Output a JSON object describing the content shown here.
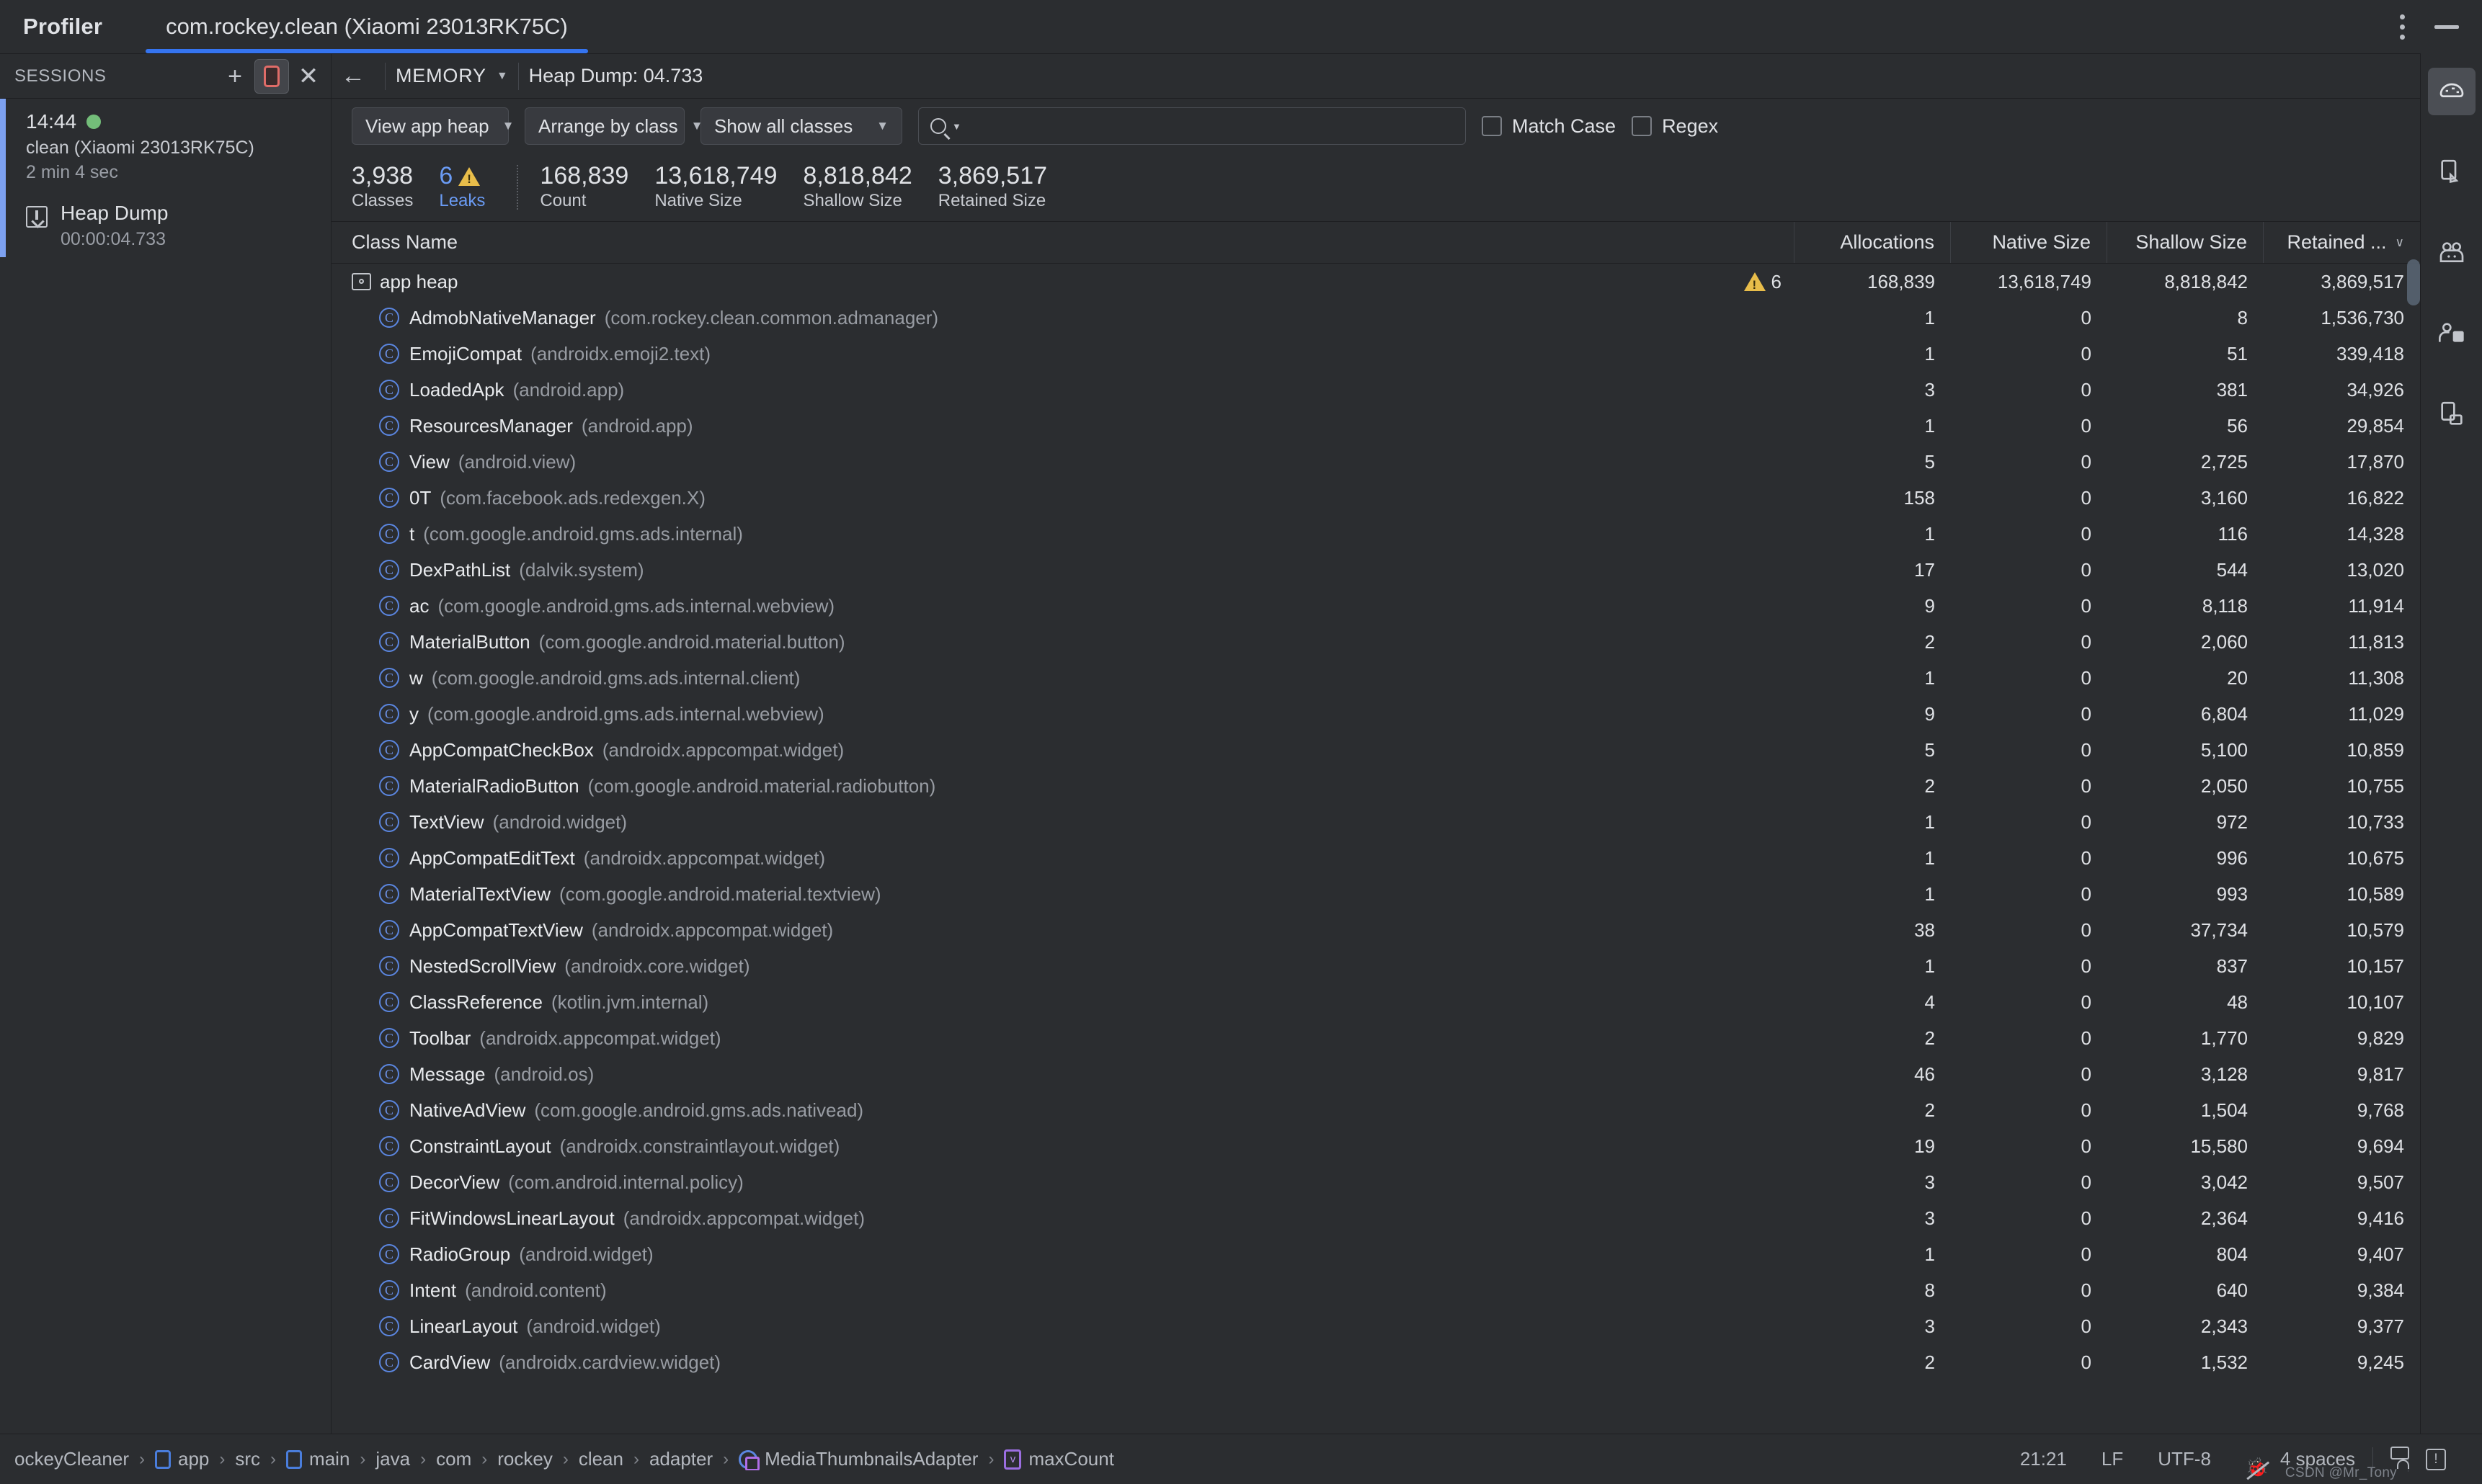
{
  "titlebar": {
    "app_label": "Profiler",
    "tab_label": "com.rockey.clean (Xiaomi 23013RK75C)",
    "more_icon": "kebab-menu-icon",
    "minimize_icon": "minimize-icon"
  },
  "sessions": {
    "header": "SESSIONS",
    "add_icon": "plus-icon",
    "stop_icon": "stop-recording-icon",
    "close_icon": "close-icon",
    "item": {
      "time": "14:44",
      "status_color": "#73bd79",
      "name": "clean (Xiaomi 23013RK75C)",
      "duration": "2 min 4 sec",
      "capture_label": "Heap Dump",
      "capture_time": "00:00:04.733",
      "capture_icon": "heap-dump-icon"
    }
  },
  "memory_bar": {
    "back_icon": "back-arrow-icon",
    "stage": "MEMORY",
    "stage_caret": "▼",
    "heap_dump_title": "Heap Dump: 04.733"
  },
  "filters": {
    "heap_select": "View app heap",
    "arrange_select": "Arrange by class",
    "show_select": "Show all classes",
    "caret": "▼",
    "search_placeholder": "",
    "search_value": "",
    "search_icon": "search-icon",
    "match_case_label": "Match Case",
    "match_case_checked": false,
    "regex_label": "Regex",
    "regex_checked": false
  },
  "stats": [
    {
      "value": "3,938",
      "label": "Classes",
      "accent": false
    },
    {
      "value": "6",
      "label": "Leaks",
      "accent": true,
      "accent_color": "#6a9bf4",
      "warn_icon": "warning-triangle-icon"
    },
    {
      "value": "168,839",
      "label": "Count",
      "accent": false
    },
    {
      "value": "13,618,749",
      "label": "Native Size",
      "accent": false
    },
    {
      "value": "8,818,842",
      "label": "Shallow Size",
      "accent": false
    },
    {
      "value": "3,869,517",
      "label": "Retained Size",
      "accent": false
    }
  ],
  "table": {
    "columns": [
      "Class Name",
      "Allocations",
      "Native Size",
      "Shallow Size",
      "Retained ..."
    ],
    "sort_caret": "∨",
    "sorted_column": "Retained ...",
    "root": {
      "label": "app heap",
      "icon": "heap-folder-icon",
      "leak_count": "6",
      "leak_icon": "warning-triangle-icon",
      "allocations": "168,839",
      "native": "13,618,749",
      "shallow": "8,818,842",
      "retained": "3,869,517"
    },
    "rows": [
      {
        "name": "AdmobNativeManager",
        "pkg": "(com.rockey.clean.common.admanager)",
        "allocations": "1",
        "native": "0",
        "shallow": "8",
        "retained": "1,536,730"
      },
      {
        "name": "EmojiCompat",
        "pkg": "(androidx.emoji2.text)",
        "allocations": "1",
        "native": "0",
        "shallow": "51",
        "retained": "339,418"
      },
      {
        "name": "LoadedApk",
        "pkg": "(android.app)",
        "allocations": "3",
        "native": "0",
        "shallow": "381",
        "retained": "34,926"
      },
      {
        "name": "ResourcesManager",
        "pkg": "(android.app)",
        "allocations": "1",
        "native": "0",
        "shallow": "56",
        "retained": "29,854"
      },
      {
        "name": "View",
        "pkg": "(android.view)",
        "allocations": "5",
        "native": "0",
        "shallow": "2,725",
        "retained": "17,870"
      },
      {
        "name": "0T",
        "pkg": "(com.facebook.ads.redexgen.X)",
        "allocations": "158",
        "native": "0",
        "shallow": "3,160",
        "retained": "16,822"
      },
      {
        "name": "t",
        "pkg": "(com.google.android.gms.ads.internal)",
        "allocations": "1",
        "native": "0",
        "shallow": "116",
        "retained": "14,328"
      },
      {
        "name": "DexPathList",
        "pkg": "(dalvik.system)",
        "allocations": "17",
        "native": "0",
        "shallow": "544",
        "retained": "13,020"
      },
      {
        "name": "ac",
        "pkg": "(com.google.android.gms.ads.internal.webview)",
        "allocations": "9",
        "native": "0",
        "shallow": "8,118",
        "retained": "11,914"
      },
      {
        "name": "MaterialButton",
        "pkg": "(com.google.android.material.button)",
        "allocations": "2",
        "native": "0",
        "shallow": "2,060",
        "retained": "11,813"
      },
      {
        "name": "w",
        "pkg": "(com.google.android.gms.ads.internal.client)",
        "allocations": "1",
        "native": "0",
        "shallow": "20",
        "retained": "11,308"
      },
      {
        "name": "y",
        "pkg": "(com.google.android.gms.ads.internal.webview)",
        "allocations": "9",
        "native": "0",
        "shallow": "6,804",
        "retained": "11,029"
      },
      {
        "name": "AppCompatCheckBox",
        "pkg": "(androidx.appcompat.widget)",
        "allocations": "5",
        "native": "0",
        "shallow": "5,100",
        "retained": "10,859"
      },
      {
        "name": "MaterialRadioButton",
        "pkg": "(com.google.android.material.radiobutton)",
        "allocations": "2",
        "native": "0",
        "shallow": "2,050",
        "retained": "10,755"
      },
      {
        "name": "TextView",
        "pkg": "(android.widget)",
        "allocations": "1",
        "native": "0",
        "shallow": "972",
        "retained": "10,733"
      },
      {
        "name": "AppCompatEditText",
        "pkg": "(androidx.appcompat.widget)",
        "allocations": "1",
        "native": "0",
        "shallow": "996",
        "retained": "10,675"
      },
      {
        "name": "MaterialTextView",
        "pkg": "(com.google.android.material.textview)",
        "allocations": "1",
        "native": "0",
        "shallow": "993",
        "retained": "10,589"
      },
      {
        "name": "AppCompatTextView",
        "pkg": "(androidx.appcompat.widget)",
        "allocations": "38",
        "native": "0",
        "shallow": "37,734",
        "retained": "10,579"
      },
      {
        "name": "NestedScrollView",
        "pkg": "(androidx.core.widget)",
        "allocations": "1",
        "native": "0",
        "shallow": "837",
        "retained": "10,157"
      },
      {
        "name": "ClassReference",
        "pkg": "(kotlin.jvm.internal)",
        "allocations": "4",
        "native": "0",
        "shallow": "48",
        "retained": "10,107"
      },
      {
        "name": "Toolbar",
        "pkg": "(androidx.appcompat.widget)",
        "allocations": "2",
        "native": "0",
        "shallow": "1,770",
        "retained": "9,829"
      },
      {
        "name": "Message",
        "pkg": "(android.os)",
        "allocations": "46",
        "native": "0",
        "shallow": "3,128",
        "retained": "9,817"
      },
      {
        "name": "NativeAdView",
        "pkg": "(com.google.android.gms.ads.nativead)",
        "allocations": "2",
        "native": "0",
        "shallow": "1,504",
        "retained": "9,768"
      },
      {
        "name": "ConstraintLayout",
        "pkg": "(androidx.constraintlayout.widget)",
        "allocations": "19",
        "native": "0",
        "shallow": "15,580",
        "retained": "9,694"
      },
      {
        "name": "DecorView",
        "pkg": "(com.android.internal.policy)",
        "allocations": "3",
        "native": "0",
        "shallow": "3,042",
        "retained": "9,507"
      },
      {
        "name": "FitWindowsLinearLayout",
        "pkg": "(androidx.appcompat.widget)",
        "allocations": "3",
        "native": "0",
        "shallow": "2,364",
        "retained": "9,416"
      },
      {
        "name": "RadioGroup",
        "pkg": "(android.widget)",
        "allocations": "1",
        "native": "0",
        "shallow": "804",
        "retained": "9,407"
      },
      {
        "name": "Intent",
        "pkg": "(android.content)",
        "allocations": "8",
        "native": "0",
        "shallow": "640",
        "retained": "9,384"
      },
      {
        "name": "LinearLayout",
        "pkg": "(android.widget)",
        "allocations": "3",
        "native": "0",
        "shallow": "2,343",
        "retained": "9,377"
      },
      {
        "name": "CardView",
        "pkg": "(androidx.cardview.widget)",
        "allocations": "2",
        "native": "0",
        "shallow": "1,532",
        "retained": "9,245"
      }
    ]
  },
  "right_strip": {
    "items": [
      {
        "icon": "profiler-icon",
        "active": true
      },
      {
        "icon": "device-file-explorer-icon",
        "active": false
      },
      {
        "icon": "emulator-icon",
        "active": false
      },
      {
        "icon": "device-manager-icon",
        "active": false
      },
      {
        "icon": "layout-inspector-icon",
        "active": false
      }
    ]
  },
  "statusbar": {
    "breadcrumbs": [
      {
        "label": "ockeyCleaner",
        "icon": ""
      },
      {
        "label": "app",
        "icon": "module-icon"
      },
      {
        "label": "src",
        "icon": ""
      },
      {
        "label": "main",
        "icon": "module-icon"
      },
      {
        "label": "java",
        "icon": ""
      },
      {
        "label": "com",
        "icon": ""
      },
      {
        "label": "rockey",
        "icon": ""
      },
      {
        "label": "clean",
        "icon": ""
      },
      {
        "label": "adapter",
        "icon": ""
      },
      {
        "label": "MediaThumbnailsAdapter",
        "icon": "kotlin-class-icon"
      },
      {
        "label": "maxCount",
        "icon": "variable-icon"
      }
    ],
    "separator": "›",
    "caret_position": "21:21",
    "line_separator": "LF",
    "encoding": "UTF-8",
    "inspections_icon": "inspections-off-icon",
    "indent": "4 spaces",
    "lock_icon": "unlocked-icon",
    "notifications_icon": "notification-bubble-icon",
    "watermark": "CSDN @Mr_Tony"
  }
}
